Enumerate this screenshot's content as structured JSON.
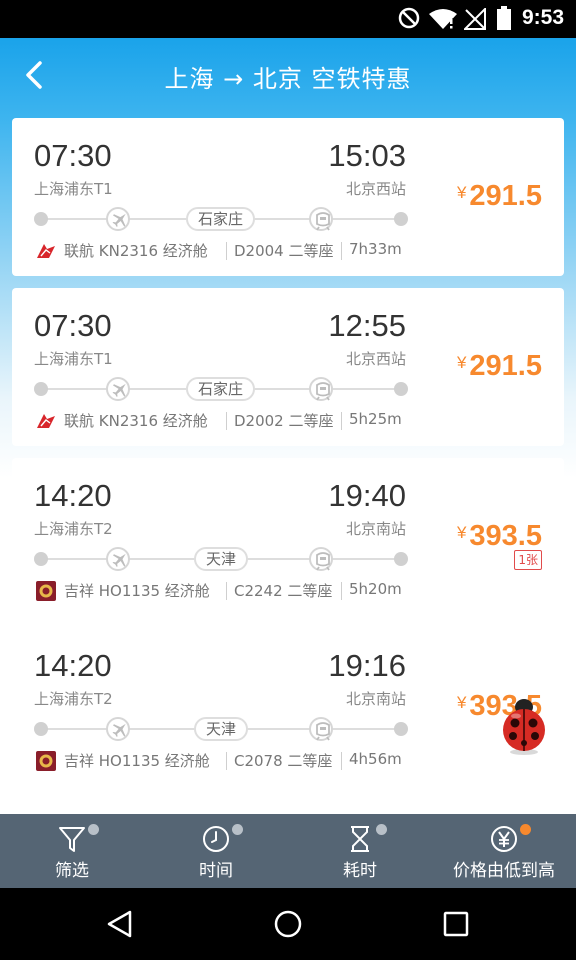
{
  "status_bar": {
    "time": "9:53"
  },
  "header": {
    "title": "上海 → 北京 空铁特惠"
  },
  "tickets": [
    {
      "dep_time": "07:30",
      "dep_place": "上海浦东T1",
      "arr_time": "15:03",
      "arr_place": "北京西站",
      "stop": "石家庄",
      "airline": "联航 KN2316 经济舱",
      "train": "D2004 二等座",
      "duration": "7h33m",
      "currency": "¥",
      "price": "291.5",
      "badge": ""
    },
    {
      "dep_time": "07:30",
      "dep_place": "上海浦东T1",
      "arr_time": "12:55",
      "arr_place": "北京西站",
      "stop": "石家庄",
      "airline": "联航 KN2316 经济舱",
      "train": "D2002 二等座",
      "duration": "5h25m",
      "currency": "¥",
      "price": "291.5",
      "badge": ""
    },
    {
      "dep_time": "14:20",
      "dep_place": "上海浦东T2",
      "arr_time": "19:40",
      "arr_place": "北京南站",
      "stop": "天津",
      "airline": "吉祥 HO1135 经济舱",
      "train": "C2242 二等座",
      "duration": "5h20m",
      "currency": "¥",
      "price": "393.5",
      "badge": "1张"
    },
    {
      "dep_time": "14:20",
      "dep_place": "上海浦东T2",
      "arr_time": "19:16",
      "arr_place": "北京南站",
      "stop": "天津",
      "airline": "吉祥 HO1135 经济舱",
      "train": "C2078 二等座",
      "duration": "4h56m",
      "currency": "¥",
      "price": "393.5",
      "badge": ""
    }
  ],
  "bottom_tabs": [
    {
      "label": "筛选",
      "icon": "filter-icon",
      "active": false
    },
    {
      "label": "时间",
      "icon": "clock-icon",
      "active": false
    },
    {
      "label": "耗时",
      "icon": "hourglass-icon",
      "active": false
    },
    {
      "label": "价格由低到高",
      "icon": "yen-icon",
      "active": true
    }
  ],
  "colors": {
    "header_blue": "#1aa3ea",
    "price_orange": "#f7892e",
    "tab_bar": "#556574",
    "badge_red": "#e14b4b"
  }
}
